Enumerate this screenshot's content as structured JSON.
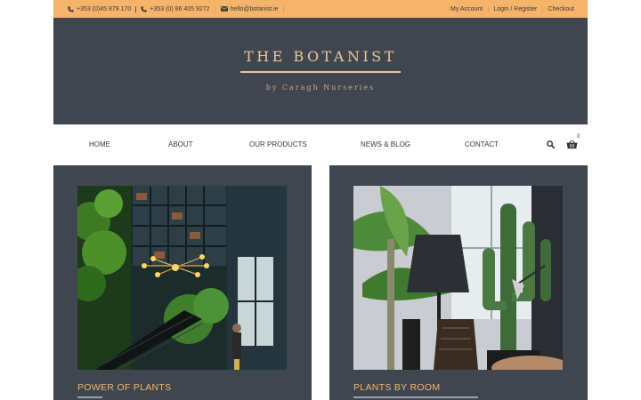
{
  "topbar": {
    "phone1": "+353 (0)45 879 170",
    "phone2": "+353 (0) 86 405 9272",
    "email": "hello@botanist.ie",
    "links": [
      "My Account",
      "Login / Register",
      "Checkout"
    ]
  },
  "header": {
    "title": "THE BOTANIST",
    "subtitle": "by Caragh Nurseries"
  },
  "nav": {
    "items": [
      "HOME",
      "ABOUT",
      "OUR PRODUCTS",
      "NEWS & BLOG",
      "CONTACT"
    ],
    "cart_count": "0"
  },
  "cards": [
    {
      "title": "POWER OF PLANTS"
    },
    {
      "title": "PLANTS BY ROOM"
    }
  ],
  "colors": {
    "accent": "#f6b46b",
    "header_bg": "#3f4650",
    "gold": "#e9c79a"
  }
}
